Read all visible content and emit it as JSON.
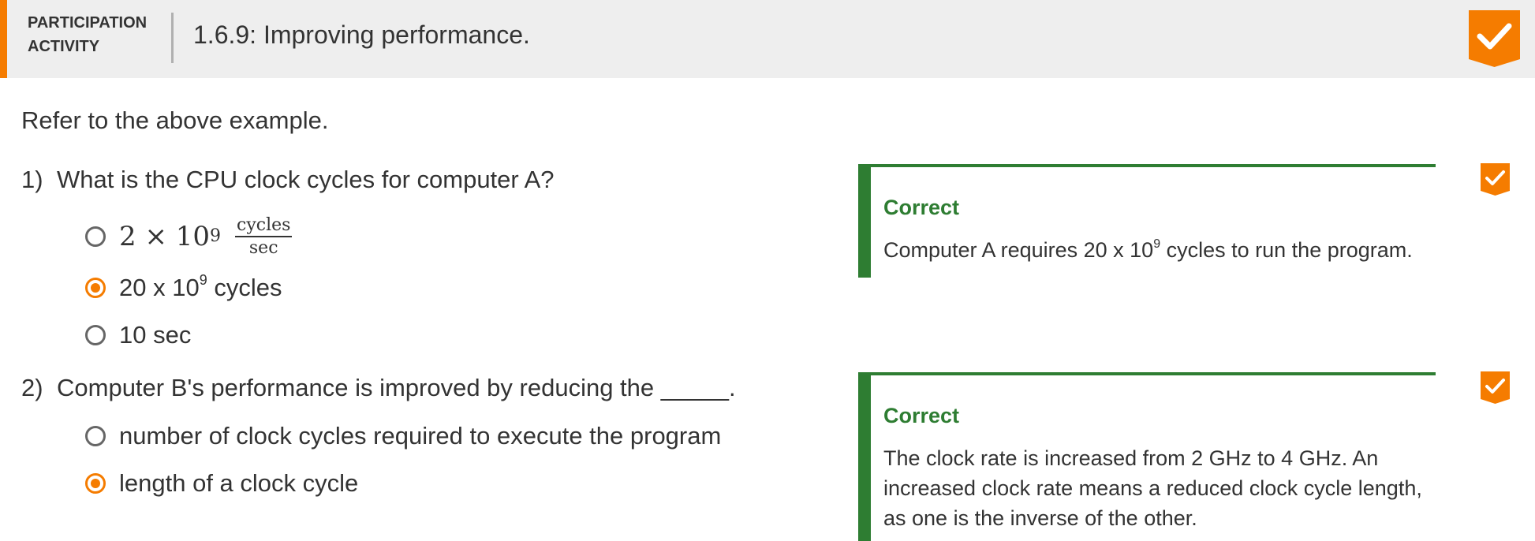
{
  "header": {
    "kind_line1": "PARTICIPATION",
    "kind_line2": "ACTIVITY",
    "title": "1.6.9: Improving performance.",
    "badge_icon": "check-icon"
  },
  "intro": "Refer to the above example.",
  "colors": {
    "accent": "#f57c00",
    "correct": "#2e7d32",
    "header_bg": "#eeeeee"
  },
  "questions": [
    {
      "number": "1)",
      "text": "What is the CPU clock cycles for computer A?",
      "options": [
        {
          "base": "2 × 10",
          "exp": "9",
          "num": "cycles",
          "den": "sec",
          "selected": false
        },
        {
          "base": "20 x 10",
          "exp": "9",
          "suffix": " cycles",
          "selected": true
        },
        {
          "text": "10 sec",
          "selected": false
        }
      ],
      "feedback": {
        "label": "Correct",
        "text_before": "Computer A requires 20 x 10",
        "text_exp": "9",
        "text_after": " cycles to run the program."
      },
      "status_icon": "check-icon"
    },
    {
      "number": "2)",
      "text": "Computer B's performance is improved by reducing the _____.",
      "options": [
        {
          "text": "number of clock cycles required to execute the program",
          "selected": false
        },
        {
          "text": "length of a clock cycle",
          "selected": true
        }
      ],
      "feedback": {
        "label": "Correct",
        "text": "The clock rate is increased from 2 GHz to 4 GHz. An increased clock rate means a reduced clock cycle length, as one is the inverse of the other."
      },
      "status_icon": "check-icon"
    }
  ]
}
